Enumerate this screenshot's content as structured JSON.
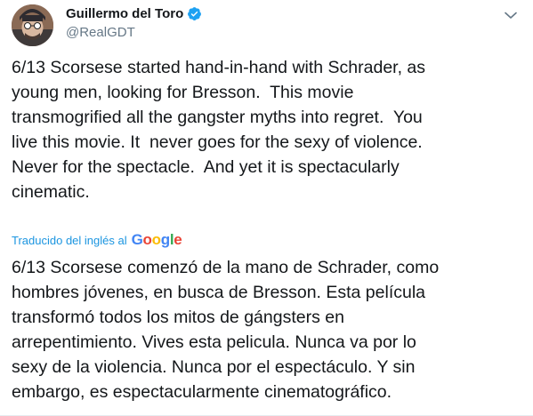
{
  "author": {
    "display_name": "Guillermo del Toro",
    "handle": "@RealGDT",
    "verified": true
  },
  "tweet": {
    "text": "6/13 Scorsese started hand-in-hand with Schrader, as\nyoung men, looking for Bresson.  This movie\ntransmogrified all the gangster myths into regret.  You\nlive this movie. It  never goes for the sexy of violence.\nNever for the spectacle.  And yet it is spectacularly\ncinematic."
  },
  "translation": {
    "label": "Traducido del inglés al",
    "provider": {
      "letters": [
        "G",
        "o",
        "o",
        "g",
        "l",
        "e"
      ],
      "colors": [
        "#4285F4",
        "#EA4335",
        "#FBBC05",
        "#4285F4",
        "#34A853",
        "#EA4335"
      ]
    },
    "text": "6/13 Scorsese comenzó de la mano de Schrader, como\nhombres jóvenes, en busca de Bresson. Esta película\ntransformó todos los mitos de gángsters en\narrepentimiento. Vives esta pelicula. Nunca va por lo\nsexy de la violencia. Nunca por el espectáculo. Y sin\nembargo, es espectacularmente cinematográfico."
  },
  "colors": {
    "link": "#1b95e0",
    "verified": "#1da1f2",
    "secondary_text": "#657786"
  }
}
